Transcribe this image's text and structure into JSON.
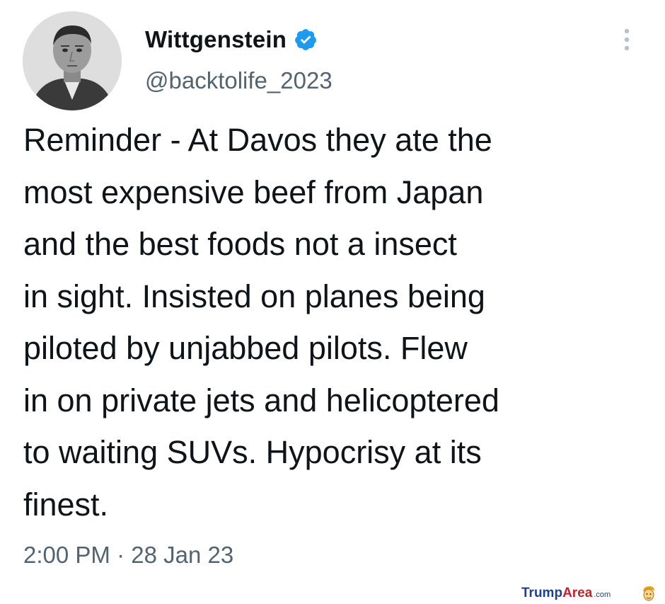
{
  "author": {
    "display_name": "Wittgenstein",
    "handle": "@backtolife_2023",
    "verified": true,
    "avatar_icon": "profile-photo",
    "verified_color": "#1d9bf0"
  },
  "menu": {
    "icon": "more-vertical-icon"
  },
  "tweet": {
    "lines": [
      "Reminder - At Davos they ate the",
      "most expensive beef from Japan",
      "and the best foods not a insect",
      "in sight. Insisted on planes being",
      "piloted by unjabbed pilots. Flew",
      "in on private jets and helicoptered",
      "to waiting SUVs. Hypocrisy at its",
      "finest."
    ]
  },
  "meta": {
    "time": "2:00 PM",
    "separator": "·",
    "date": "28 Jan 23"
  },
  "watermark": {
    "part1": "Trump",
    "part2": "Area",
    "suffix": ".com"
  },
  "colors": {
    "text": "#0f1419",
    "secondary": "#536471",
    "background": "#ffffff"
  }
}
